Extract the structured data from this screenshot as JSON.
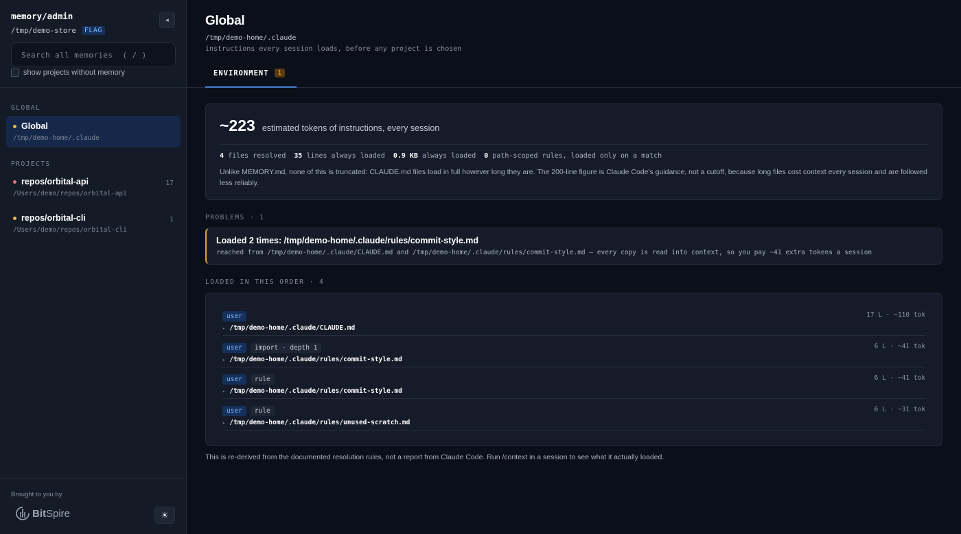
{
  "sidebar": {
    "brand": "memory/admin",
    "store_path": "/tmp/demo-store",
    "flag": "FLAG",
    "search_placeholder": "Search all memories  ( / )",
    "show_projects_label": "show projects without memory",
    "global_section": "GLOBAL",
    "projects_section": "PROJECTS",
    "global_item": {
      "title": "Global",
      "path": "/tmp/demo-home/.claude",
      "dot_color": "#f5b73b"
    },
    "projects": [
      {
        "title": "repos/orbital-api",
        "path": "/Users/demo/repos/orbital-api",
        "count": "17",
        "dot_color": "#f07178"
      },
      {
        "title": "repos/orbital-cli",
        "path": "/Users/demo/repos/orbital-cli",
        "count": "1",
        "dot_color": "#f5b73b"
      }
    ],
    "footer": {
      "brought_by": "Brought to you by",
      "logo_bold": "Bit",
      "logo_rest": "Spire"
    }
  },
  "main": {
    "title": "Global",
    "path": "/tmp/demo-home/.claude",
    "subtitle": "instructions every session loads, before any project is chosen",
    "tab": {
      "label": "ENVIRONMENT",
      "badge": "1"
    },
    "summary": {
      "tokens": "~223",
      "tokens_desc": "estimated tokens of instructions, every session",
      "files_count": "4",
      "files_label": "files resolved",
      "lines_count": "35",
      "lines_label": "lines always loaded",
      "size": "0.9 KB",
      "size_label": "always loaded",
      "scoped_count": "0",
      "scoped_label": "path-scoped rules, loaded only on a match",
      "note": "Unlike MEMORY.md, none of this is truncated: CLAUDE.md files load in full however long they are. The 200-line figure is Claude Code's guidance, not a cutoff, because long files cost context every session and are followed less reliably."
    },
    "problems_label": "PROBLEMS · 1",
    "problem": {
      "title": "Loaded 2 times: /tmp/demo-home/.claude/rules/commit-style.md",
      "detail": "reached from /tmp/demo-home/.claude/CLAUDE.md and /tmp/demo-home/.claude/rules/commit-style.md — every copy is read into context, so you pay ~41 extra tokens a session"
    },
    "loaded_label": "LOADED IN THIS ORDER · 4",
    "files": [
      {
        "scope": "user",
        "extra": "",
        "path": "/tmp/demo-home/.claude/CLAUDE.md",
        "meta": "17 L · ~110 tok"
      },
      {
        "scope": "user",
        "extra": "import · depth 1",
        "path": "/tmp/demo-home/.claude/rules/commit-style.md",
        "meta": "6 L · ~41 tok"
      },
      {
        "scope": "user",
        "extra": "rule",
        "path": "/tmp/demo-home/.claude/rules/commit-style.md",
        "meta": "6 L · ~41 tok"
      },
      {
        "scope": "user",
        "extra": "rule",
        "path": "/tmp/demo-home/.claude/rules/unused-scratch.md",
        "meta": "6 L · ~31 tok"
      }
    ],
    "footnote": "This is re-derived from the documented resolution rules, not a report from Claude Code. Run /context in a session to see what it actually loaded."
  }
}
